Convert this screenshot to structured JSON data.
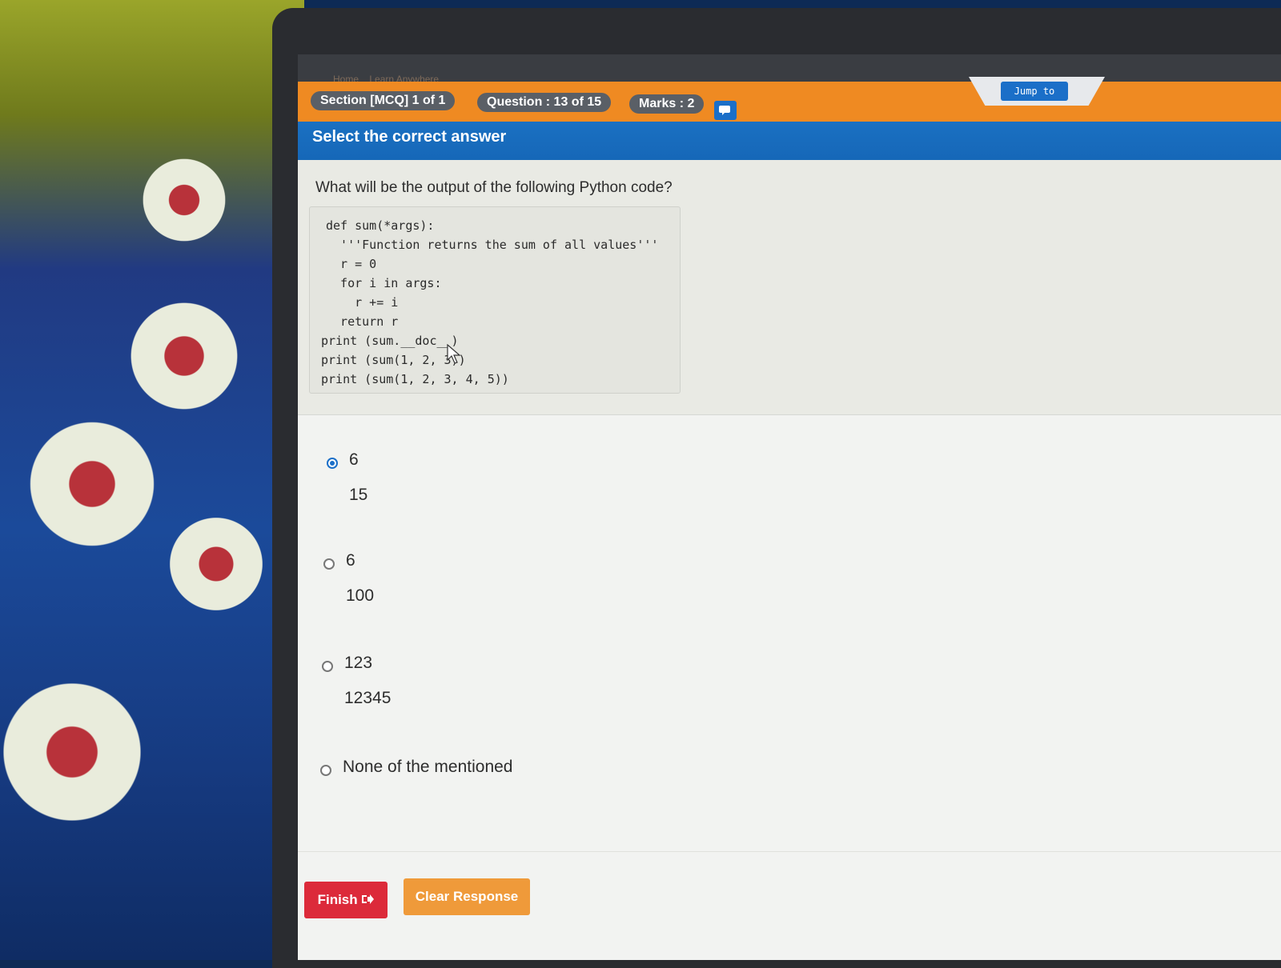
{
  "breadcrumb": {
    "home": "Home",
    "current": "Learn Anywhere"
  },
  "header": {
    "section_label": "Section [MCQ] 1 of 1",
    "question_label": "Question : 13 of 15",
    "marks_label": "Marks : 2",
    "chat_icon": "chat-icon",
    "jump_label": "Jump to"
  },
  "banner": {
    "title": "Select the correct answer"
  },
  "question": {
    "text": "What will be the output of the following Python code?",
    "code": [
      "def sum(*args):",
      "  '''Function returns the sum of all values'''",
      "  r = 0",
      "  for i in args:",
      "    r += i",
      "  return r",
      "print (sum.__doc__)",
      "print (sum(1, 2, 3))",
      "print (sum(1, 2, 3, 4, 5))"
    ]
  },
  "options": [
    {
      "lines": [
        "6",
        "15"
      ],
      "selected": true
    },
    {
      "lines": [
        "6",
        "100"
      ],
      "selected": false
    },
    {
      "lines": [
        "123",
        "12345"
      ],
      "selected": false
    },
    {
      "lines": [
        "None of the mentioned"
      ],
      "selected": false
    }
  ],
  "footer": {
    "finish_label": "Finish",
    "clear_label": "Clear Response"
  },
  "colors": {
    "orange": "#ef8a22",
    "blue": "#1565b5",
    "finish": "#dc2a3a",
    "clear": "#ef9a3a"
  }
}
